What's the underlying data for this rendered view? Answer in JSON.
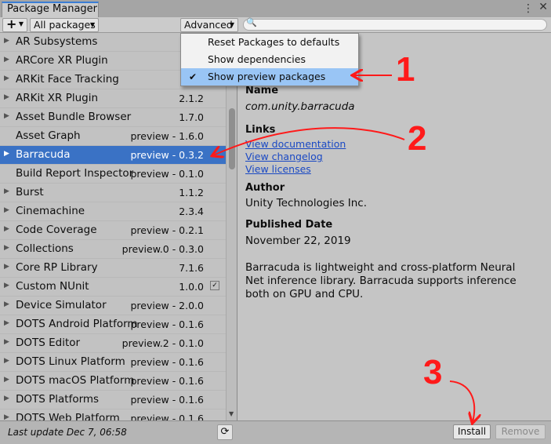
{
  "window": {
    "tab_title": "Package Manager"
  },
  "toolbar": {
    "add_label": "+",
    "filter_label": "All packages",
    "advanced_label": "Advanced",
    "search_placeholder": ""
  },
  "packages": [
    {
      "name": "AR Subsystems",
      "version": "",
      "has_arrow": true
    },
    {
      "name": "ARCore XR Plugin",
      "version": "",
      "has_arrow": true
    },
    {
      "name": "ARKit Face Tracking",
      "version": "",
      "has_arrow": true
    },
    {
      "name": "ARKit XR Plugin",
      "version": "2.1.2",
      "has_arrow": true
    },
    {
      "name": "Asset Bundle Browser",
      "version": "1.7.0",
      "has_arrow": true
    },
    {
      "name": "Asset Graph",
      "version": "preview - 1.6.0",
      "has_arrow": false
    },
    {
      "name": "Barracuda",
      "version": "preview - 0.3.2",
      "has_arrow": true,
      "selected": true
    },
    {
      "name": "Build Report Inspector",
      "version": "preview - 0.1.0",
      "has_arrow": false
    },
    {
      "name": "Burst",
      "version": "1.1.2",
      "has_arrow": true
    },
    {
      "name": "Cinemachine",
      "version": "2.3.4",
      "has_arrow": true
    },
    {
      "name": "Code Coverage",
      "version": "preview - 0.2.1",
      "has_arrow": true
    },
    {
      "name": "Collections",
      "version": "preview.0 - 0.3.0",
      "has_arrow": true
    },
    {
      "name": "Core RP Library",
      "version": "7.1.6",
      "has_arrow": true
    },
    {
      "name": "Custom NUnit",
      "version": "1.0.0",
      "has_arrow": true,
      "installed_check": true
    },
    {
      "name": "Device Simulator",
      "version": "preview - 2.0.0",
      "has_arrow": true
    },
    {
      "name": "DOTS Android Platform",
      "version": "preview - 0.1.6",
      "has_arrow": true
    },
    {
      "name": "DOTS Editor",
      "version": "preview.2 - 0.1.0",
      "has_arrow": true
    },
    {
      "name": "DOTS Linux Platform",
      "version": "preview - 0.1.6",
      "has_arrow": true
    },
    {
      "name": "DOTS macOS Platform",
      "version": "preview - 0.1.6",
      "has_arrow": true
    },
    {
      "name": "DOTS Platforms",
      "version": "preview - 0.1.6",
      "has_arrow": true
    },
    {
      "name": "DOTS Web Platform",
      "version": "preview - 0.1.6",
      "has_arrow": true
    }
  ],
  "advanced_menu": [
    {
      "label": "Reset Packages to defaults",
      "checked": false
    },
    {
      "label": "Show dependencies",
      "checked": false
    },
    {
      "label": "Show preview packages",
      "checked": true
    }
  ],
  "details": {
    "name_label": "Name",
    "package_id": "com.unity.barracuda",
    "links_label": "Links",
    "link_documentation": "View documentation",
    "link_changelog": "View changelog",
    "link_licenses": "View licenses",
    "author_label": "Author",
    "author": "Unity Technologies Inc.",
    "published_label": "Published Date",
    "published_date": "November 22,  2019",
    "description": "Barracuda is lightweight and cross-platform Neural Net inference library. Barracuda supports inference both on GPU and CPU."
  },
  "bottom": {
    "last_update": "Last update Dec 7, 06:58",
    "install_label": "Install",
    "remove_label": "Remove"
  },
  "annotations": [
    "1",
    "2",
    "3"
  ],
  "colors": {
    "selected_row": "#3a72c5",
    "menu_highlight": "#99c5f5",
    "annotation": "#ff1a1a",
    "link": "#1a49c4"
  }
}
